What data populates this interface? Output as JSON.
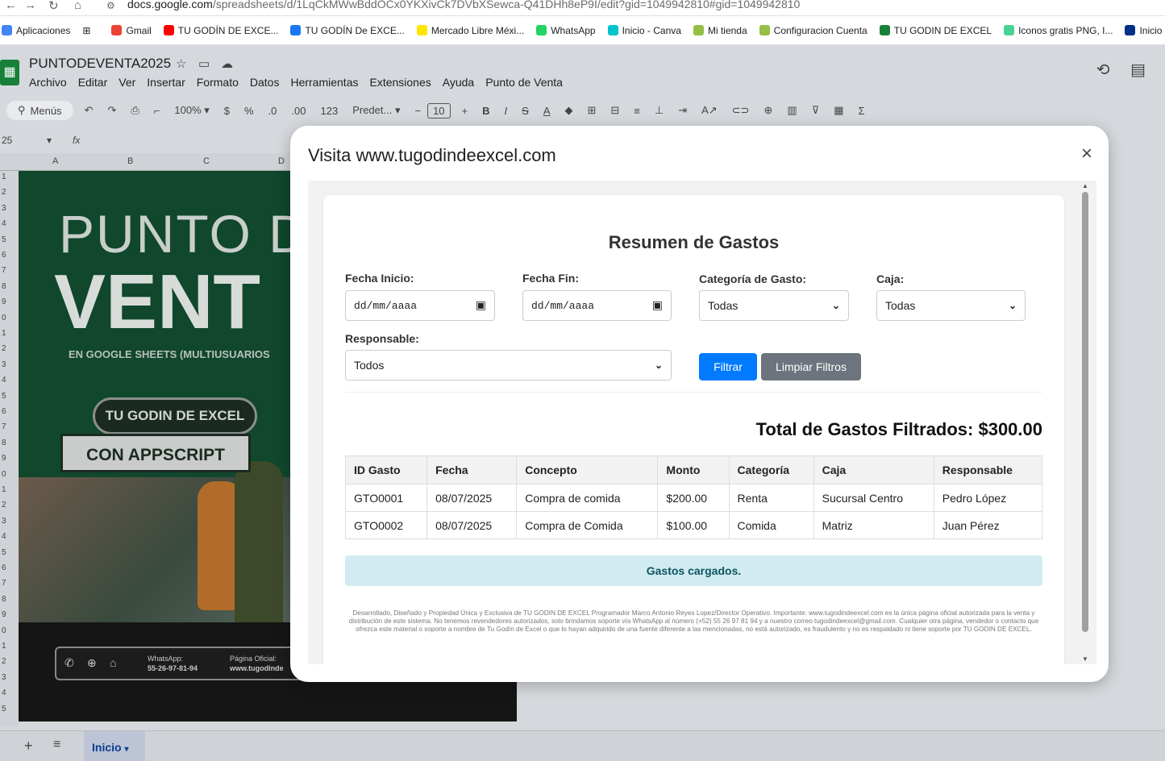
{
  "browser": {
    "url_main": "docs.google.com",
    "url_rest": "/spreadsheets/d/1LqCkMWwBddOCx0YKXivCk7DVbXSewca-Q41DHh8eP9I/edit?gid=1049942810#gid=1049942810",
    "bookmarks": [
      {
        "label": "Aplicaciones",
        "icon": "apps-grid-icon",
        "color": "#4285f4"
      },
      {
        "label": "Gmail",
        "icon": "gmail-icon",
        "color": "#ea4335"
      },
      {
        "label": "TU GODÍN DE EXCE...",
        "icon": "youtube-icon",
        "color": "#ff0000"
      },
      {
        "label": "TU GODÍN De EXCE...",
        "icon": "facebook-icon",
        "color": "#1877f2"
      },
      {
        "label": "Mercado Libre Méxi...",
        "icon": "mercadolibre-icon",
        "color": "#ffe600"
      },
      {
        "label": "WhatsApp",
        "icon": "whatsapp-icon",
        "color": "#25d366"
      },
      {
        "label": "Inicio - Canva",
        "icon": "canva-icon",
        "color": "#00c4cc"
      },
      {
        "label": "Mi tienda",
        "icon": "shopify-icon",
        "color": "#95bf47"
      },
      {
        "label": "Configuracion Cuenta",
        "icon": "shopify-icon",
        "color": "#95bf47"
      },
      {
        "label": "TU GODIN DE EXCEL",
        "icon": "site-icon",
        "color": "#188038"
      },
      {
        "label": "Iconos gratis PNG, I...",
        "icon": "flaticon-icon",
        "color": "#4ad295"
      },
      {
        "label": "Inicio - PayPal",
        "icon": "paypal-icon",
        "color": "#003087"
      }
    ]
  },
  "sheets": {
    "title": "PUNTODEVENTA2025",
    "menu": [
      "Archivo",
      "Editar",
      "Ver",
      "Insertar",
      "Formato",
      "Datos",
      "Herramientas",
      "Extensiones",
      "Ayuda",
      "Punto de Venta"
    ],
    "toolbar": {
      "menus": "Menús",
      "zoom": "100%",
      "currency": "$",
      "percent": "%",
      "dec_minus": ".0",
      "dec_plus": ".00",
      "num_format": "123",
      "font": "Predet...",
      "font_size": "10"
    },
    "cell_ref": "25",
    "columns": [
      "A",
      "B",
      "C",
      "D"
    ],
    "rows": [
      "1",
      "2",
      "3",
      "4",
      "5",
      "6",
      "7",
      "8",
      "9",
      "0",
      "1",
      "2",
      "3",
      "4",
      "5",
      "6",
      "7",
      "8",
      "9",
      "0",
      "1",
      "2",
      "3",
      "4",
      "5",
      "6",
      "7",
      "8",
      "9",
      "0",
      "1",
      "2",
      "3",
      "4",
      "5"
    ],
    "banner": {
      "line1": "PUNTO D",
      "line2": "VENT",
      "subtitle": "EN GOOGLE SHEETS (MULTIUSUARIOS",
      "pill1": "TU GODIN DE EXCEL",
      "pill2": "CON APPSCRIPT",
      "whatsapp_label": "WhatsApp:",
      "whatsapp_number": "55-26-97-81-94",
      "site_label": "Página Oficial:",
      "site_value": "www.tugodinde"
    },
    "sheet_tab": "Inicio"
  },
  "modal": {
    "title": "Visita www.tugodindeexcel.com",
    "close": "×",
    "report": {
      "title": "Resumen de Gastos",
      "filters": {
        "start_label": "Fecha Inicio:",
        "start_value": "dd/mm/aaaa",
        "end_label": "Fecha Fin:",
        "end_value": "dd/mm/aaaa",
        "category_label": "Categoría de Gasto:",
        "category_value": "Todas",
        "box_label": "Caja:",
        "box_value": "Todas",
        "owner_label": "Responsable:",
        "owner_value": "Todos",
        "filter_button": "Filtrar",
        "clear_button": "Limpiar Filtros"
      },
      "total_text": "Total de Gastos Filtrados: $300.00",
      "table": {
        "headers": [
          "ID Gasto",
          "Fecha",
          "Concepto",
          "Monto",
          "Categoría",
          "Caja",
          "Responsable"
        ],
        "rows": [
          [
            "GTO0001",
            "08/07/2025",
            "Compra de comida",
            "$200.00",
            "Renta",
            "Sucursal Centro",
            "Pedro López"
          ],
          [
            "GTO0002",
            "08/07/2025",
            "Compra de Comida",
            "$100.00",
            "Comida",
            "Matriz",
            "Juan Pérez"
          ]
        ]
      },
      "status": "Gastos cargados.",
      "footer": "Desarrollado, Diseñado y Propiedad Única y Exclusiva de TU GODIN DE EXCEL Programador Marco Antonio Reyes Lopez/Director Operativo. Importante: www.tugodindeexcel.com es la única página oficial autorizada para la venta y distribución de este sistema. No tenemos revendedores autorizados, solo brindamos soporte vía WhatsApp al número (+52) 55 26 97 81 94 y a nuestro correo tugodindeexcel@gmail.com. Cualquier otra página, vendedor o contacto que ofrezca este material o soporte a nombre de Tu Godín de Excel o que lo hayan adquirido de una fuente diferente a las mencionadas, no está autorizado, es fraudulento y no es respaldado ni tiene soporte por TU GODIN DE EXCEL."
    }
  },
  "colors": {
    "primary": "#007bff",
    "secondary": "#6c757d",
    "status_bg": "#d1ecf1",
    "status_text": "#0c5460",
    "sheets_green": "#188038"
  }
}
